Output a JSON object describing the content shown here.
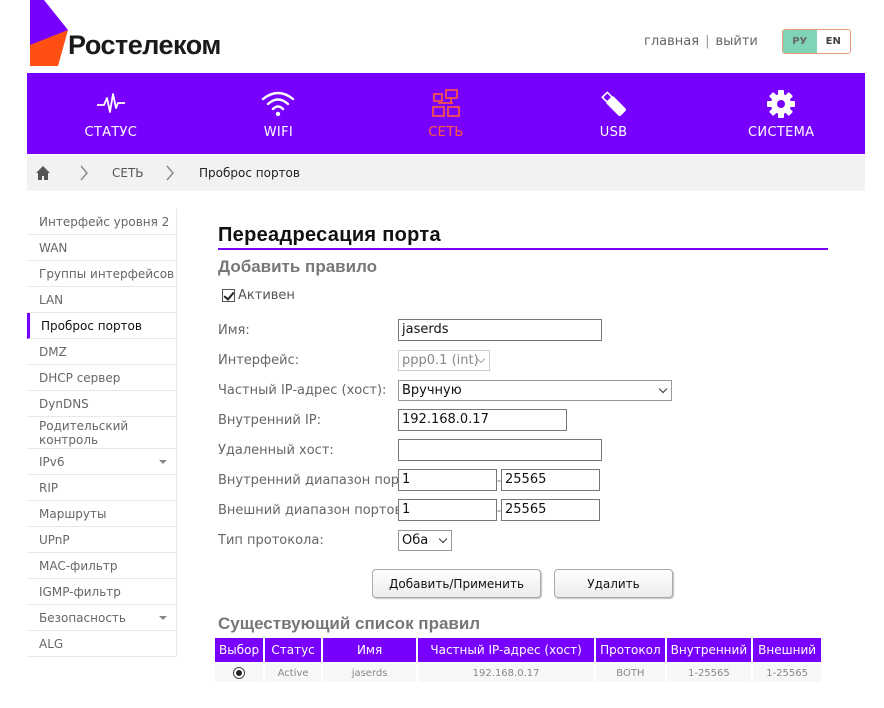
{
  "brand": {
    "name": "Ростелеком",
    "accent": "#7700ff",
    "active_color": "#ff5a3c"
  },
  "top_links": {
    "home": "главная",
    "separator": "|",
    "logout": "выйти"
  },
  "lang": {
    "ru": "РУ",
    "en": "EN"
  },
  "nav": [
    {
      "label": "СТАТУС",
      "icon": "pulse-icon"
    },
    {
      "label": "WIFI",
      "icon": "wifi-icon"
    },
    {
      "label": "СЕТЬ",
      "icon": "network-icon",
      "active": true
    },
    {
      "label": "USB",
      "icon": "usb-icon"
    },
    {
      "label": "СИСТЕМА",
      "icon": "gear-icon"
    }
  ],
  "breadcrumb": {
    "section": "СЕТЬ",
    "page": "Проброс портов"
  },
  "sidebar": [
    "Интерфейс уровня 2",
    "WAN",
    "Группы интерфейсов",
    "LAN",
    "Проброс портов",
    "DMZ",
    "DHCP сервер",
    "DynDNS",
    "Родительский контроль",
    "IPv6",
    "RIP",
    "Маршруты",
    "UPnP",
    "MAC-фильтр",
    "IGMP-фильтр",
    "Безопасность",
    "ALG"
  ],
  "main": {
    "title": "Переадресация порта",
    "subtitle": "Добавить правило",
    "active_label": "Активен",
    "fields": {
      "name_label": "Имя:",
      "name_value": "jaserds",
      "iface_label": "Интерфейс:",
      "iface_value": "ppp0.1 (int)",
      "private_ip_label": "Частный IP-адрес (хост):",
      "private_ip_value": "Вручную",
      "internal_ip_label": "Внутренний IP:",
      "internal_ip_value": "192.168.0.17",
      "remote_host_label": "Удаленный хост:",
      "remote_host_value": "",
      "internal_range_label": "Внутренний диапазон портов:",
      "internal_range_from": "1",
      "internal_range_to": "25565",
      "external_range_label": "Внешний диапазон портов:",
      "external_range_from": "1",
      "external_range_to": "25565",
      "protocol_label": "Тип протокола:",
      "protocol_value": "Оба",
      "range_sep": "-"
    },
    "buttons": {
      "apply": "Добавить/Применить",
      "delete": "Удалить"
    },
    "list_title": "Существующий список правил",
    "table": {
      "headers": [
        "Выбор",
        "Статус",
        "Имя",
        "Частный IP-адрес (хост)",
        "Протокол",
        "Внутренний",
        "Внешний"
      ],
      "rows": [
        {
          "status": "Active",
          "name": "jaserds",
          "host": "192.168.0.17",
          "protocol": "BOTH",
          "internal": "1-25565",
          "external": "1-25565"
        }
      ]
    }
  }
}
